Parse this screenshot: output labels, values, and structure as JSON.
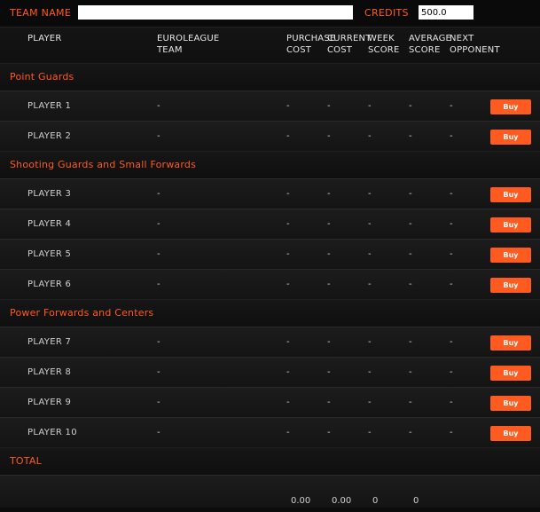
{
  "topbar": {
    "team_label": "TEAM NAME",
    "team_value": "",
    "credits_label": "CREDITS",
    "credits_value": "500.0"
  },
  "columns": {
    "player": "PLAYER",
    "team_l1": "EUROLEAGUE",
    "team_l2": "TEAM",
    "purchase_l1": "PURCHASE",
    "purchase_l2": "COST",
    "current_l1": "CURRENT",
    "current_l2": "COST",
    "week_l1": "WEEK",
    "week_l2": "SCORE",
    "avg_l1": "AVERAGE",
    "avg_l2": "SCORE",
    "next_l1": "NEXT",
    "next_l2": "OPPONENT"
  },
  "sections": [
    {
      "title": "Point Guards",
      "players": [
        {
          "name": "PLAYER 1",
          "team": "-",
          "purchase": "-",
          "current": "-",
          "week": "-",
          "avg": "-",
          "next": "-",
          "buy": "Buy"
        },
        {
          "name": "PLAYER 2",
          "team": "-",
          "purchase": "-",
          "current": "-",
          "week": "-",
          "avg": "-",
          "next": "-",
          "buy": "Buy"
        }
      ]
    },
    {
      "title": "Shooting Guards and Small Forwards",
      "players": [
        {
          "name": "PLAYER 3",
          "team": "-",
          "purchase": "-",
          "current": "-",
          "week": "-",
          "avg": "-",
          "next": "-",
          "buy": "Buy"
        },
        {
          "name": "PLAYER 4",
          "team": "-",
          "purchase": "-",
          "current": "-",
          "week": "-",
          "avg": "-",
          "next": "-",
          "buy": "Buy"
        },
        {
          "name": "PLAYER 5",
          "team": "-",
          "purchase": "-",
          "current": "-",
          "week": "-",
          "avg": "-",
          "next": "-",
          "buy": "Buy"
        },
        {
          "name": "PLAYER 6",
          "team": "-",
          "purchase": "-",
          "current": "-",
          "week": "-",
          "avg": "-",
          "next": "-",
          "buy": "Buy"
        }
      ]
    },
    {
      "title": "Power Forwards and Centers",
      "players": [
        {
          "name": "PLAYER 7",
          "team": "-",
          "purchase": "-",
          "current": "-",
          "week": "-",
          "avg": "-",
          "next": "-",
          "buy": "Buy"
        },
        {
          "name": "PLAYER 8",
          "team": "-",
          "purchase": "-",
          "current": "-",
          "week": "-",
          "avg": "-",
          "next": "-",
          "buy": "Buy"
        },
        {
          "name": "PLAYER 9",
          "team": "-",
          "purchase": "-",
          "current": "-",
          "week": "-",
          "avg": "-",
          "next": "-",
          "buy": "Buy"
        },
        {
          "name": "PLAYER 10",
          "team": "-",
          "purchase": "-",
          "current": "-",
          "week": "-",
          "avg": "-",
          "next": "-",
          "buy": "Buy"
        }
      ]
    }
  ],
  "total": {
    "label": "TOTAL",
    "purchase": "0.00",
    "current": "0.00",
    "week": "0",
    "avg": "0"
  },
  "colors": {
    "accent": "#ff5a1f",
    "background": "#0c0c0c"
  }
}
